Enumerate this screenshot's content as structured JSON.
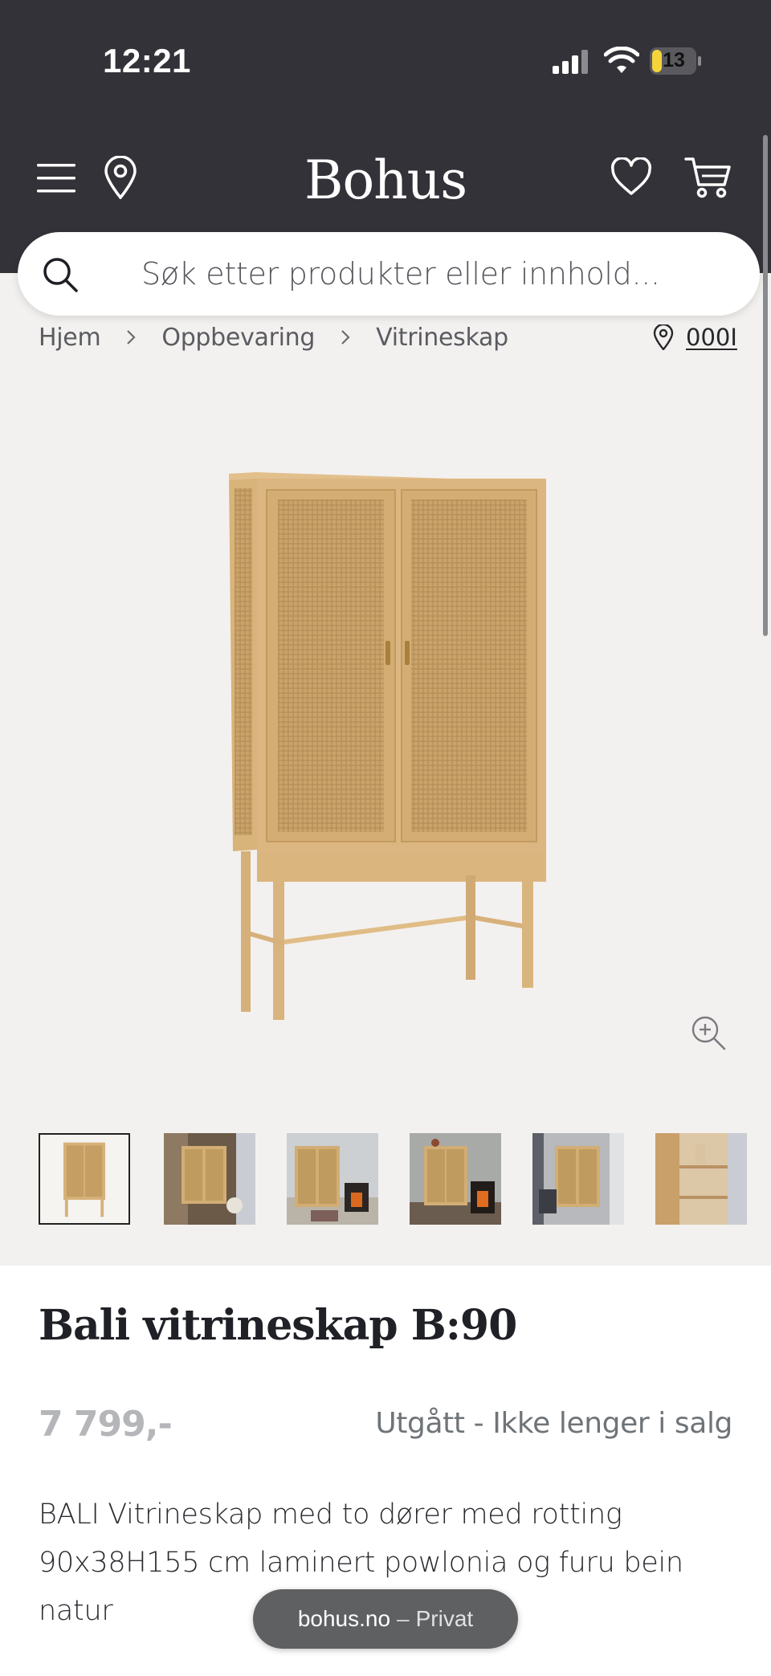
{
  "status_bar": {
    "time": "12:21",
    "battery_level": "13",
    "battery_color": "#f5d43a",
    "icons": [
      "signal-icon",
      "wifi-icon",
      "battery-icon"
    ]
  },
  "header": {
    "logo": "Bohus",
    "icons": [
      "menu-icon",
      "location-icon",
      "heart-icon",
      "cart-icon"
    ],
    "background": "#323238"
  },
  "search": {
    "placeholder": "Søk etter produkter eller innhold..."
  },
  "breadcrumb": {
    "items": [
      "Hjem",
      "Oppbevaring",
      "Vitrineskap"
    ],
    "store_code": "000I"
  },
  "gallery": {
    "thumbnail_count": 6,
    "active_index": 0
  },
  "product": {
    "title": "Bali vitrineskap B:90",
    "price": "7 799,-",
    "status": "Utgått - Ikke lenger i salg",
    "description": "BALI Vitrineskap med to dører med rotting 90x38H155 cm laminert powlonia og furu bein natur"
  },
  "browser": {
    "domain": "bohus.no",
    "separator": "–",
    "mode": "Privat"
  }
}
